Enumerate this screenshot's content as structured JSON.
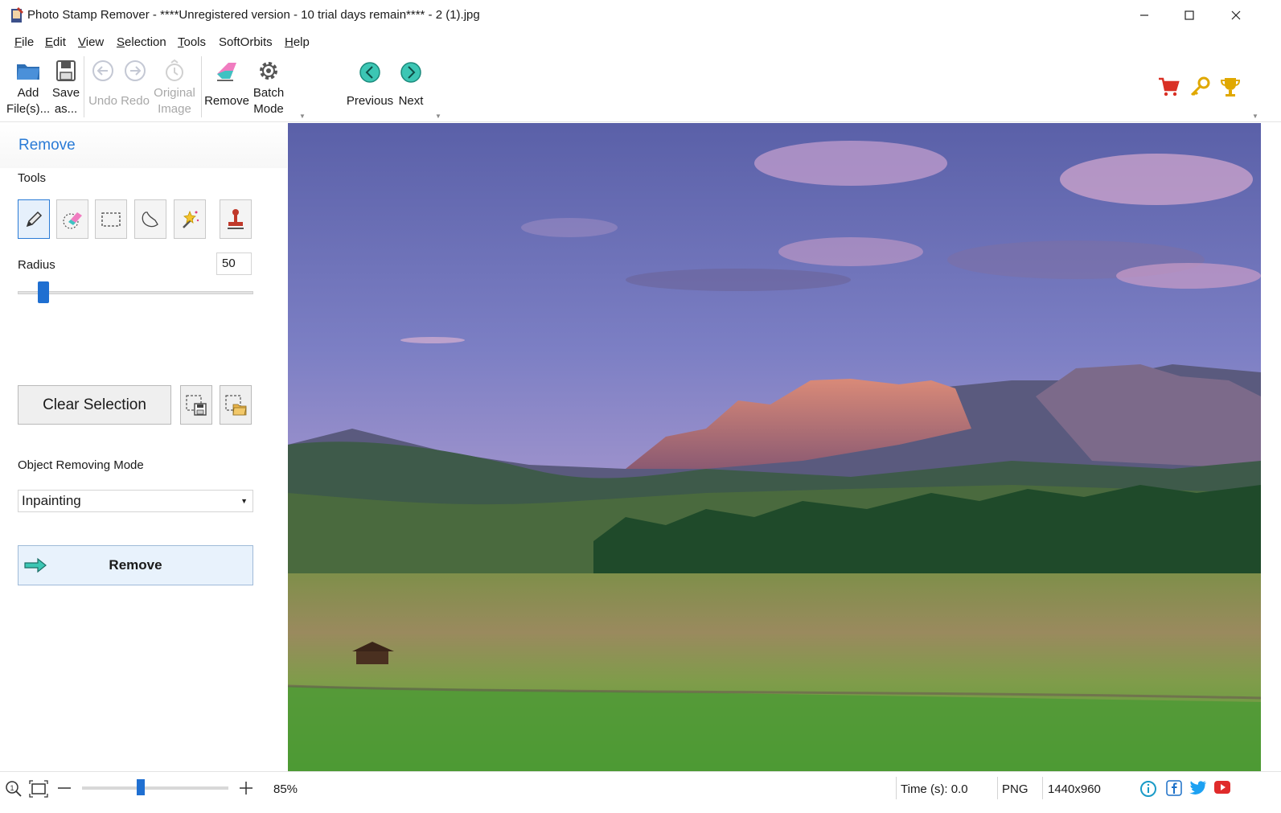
{
  "window": {
    "title": "Photo Stamp Remover - ****Unregistered version - 10 trial days remain**** - 2 (1).jpg",
    "controls": [
      "minimize",
      "maximize",
      "close"
    ]
  },
  "menu": {
    "items": [
      {
        "label": "File",
        "underline": "F",
        "rest": "ile"
      },
      {
        "label": "Edit",
        "underline": "E",
        "rest": "dit"
      },
      {
        "label": "View",
        "underline": "V",
        "rest": "iew"
      },
      {
        "label": "Selection",
        "underline": "S",
        "rest": "election"
      },
      {
        "label": "Tools",
        "underline": "T",
        "rest": "ools"
      },
      {
        "label": "SoftOrbits",
        "underline": "",
        "rest": "SoftOrbits"
      },
      {
        "label": "Help",
        "underline": "H",
        "rest": "elp"
      }
    ]
  },
  "toolbar": {
    "add_files": "Add\nFile(s)...",
    "save_as": "Save\nas...",
    "undo": "Undo",
    "redo": "Redo",
    "original_image": "Original\nImage",
    "remove": "Remove",
    "batch_mode": "Batch\nMode",
    "previous": "Previous",
    "next": "Next",
    "icons": [
      "folder-icon",
      "floppy-icon",
      "undo-icon",
      "redo-icon",
      "original-image-icon",
      "eraser-icon",
      "gear-icon",
      "prev-arrow-icon",
      "next-arrow-icon",
      "cart-icon",
      "key-icon",
      "trophy-icon"
    ]
  },
  "panel": {
    "title": "Remove",
    "tools_label": "Tools",
    "tools": [
      "pencil-tool",
      "eraser-tool",
      "rect-select-tool",
      "lasso-tool",
      "magic-wand-tool",
      "stamp-tool"
    ],
    "radius_label": "Radius",
    "radius_value": "50",
    "radius_fraction": 0.11,
    "clear_selection": "Clear Selection",
    "mode_label": "Object Removing Mode",
    "mode_value": "Inpainting",
    "remove_button": "Remove"
  },
  "statusbar": {
    "zoom": "85%",
    "zoom_fraction": 0.4,
    "time": "Time (s): 0.0",
    "format": "PNG",
    "dimensions": "1440x960",
    "colors": {
      "accent": "#1f6fd1",
      "link": "#2a7bd6"
    }
  }
}
